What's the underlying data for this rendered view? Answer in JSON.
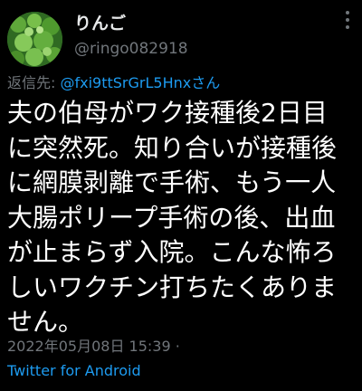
{
  "tweet": {
    "display_name": "りんご",
    "handle": "@ringo082918",
    "reply_prefix": "返信先: ",
    "reply_user": "@fxi9ttSrGrL5Hnx",
    "reply_suffix": "さん",
    "body_lines": [
      "夫の伯母がワク接種後2日目",
      "に突然死。知り合いが接種後",
      "に網膜剥離で手術、もう一人",
      "大腸ポリープ手術の後、出血",
      "が止まらず入院。こんな怖ろ",
      "しいワクチン打ちたくありま",
      "せん。"
    ],
    "timestamp": "2022年05月08日 15:39 ·",
    "source": "Twitter for Android",
    "icons": {
      "avatar": "avatar-clover-photo",
      "more": "more-options-vertical-dots-icon"
    },
    "colors": {
      "background": "#000000",
      "text": "#e7e9ea",
      "muted": "#71767b",
      "link": "#1d9bf0"
    }
  }
}
